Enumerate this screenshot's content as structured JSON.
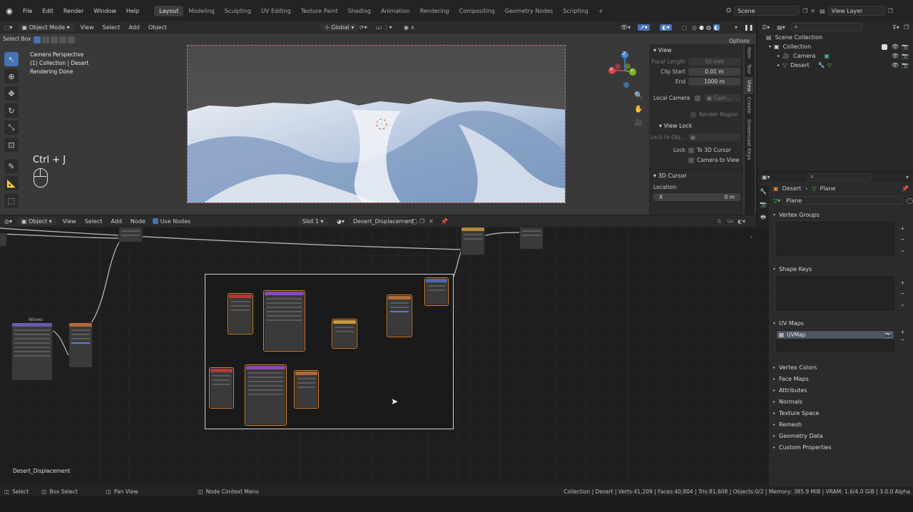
{
  "topbar": {
    "menus": [
      "File",
      "Edit",
      "Render",
      "Window",
      "Help"
    ],
    "workspaces": [
      "Layout",
      "Modeling",
      "Sculpting",
      "UV Editing",
      "Texture Paint",
      "Shading",
      "Animation",
      "Rendering",
      "Compositing",
      "Geometry Nodes",
      "Scripting"
    ],
    "active_workspace": "Layout",
    "add_tab": "+",
    "scene_name": "Scene",
    "view_layer": "View Layer"
  },
  "viewport_header": {
    "select_box": "Select Box",
    "mode": "Object Mode",
    "menus": [
      "View",
      "Select",
      "Add",
      "Object"
    ],
    "transform_orientation": "Global",
    "options": "Options"
  },
  "viewport": {
    "overlay_lines": [
      "Camera Perspective",
      "(1) Collection | Desert",
      "Rendering Done"
    ],
    "shortcut_label": "Ctrl + J",
    "gizmo_axes": {
      "x": "X",
      "y": "Y",
      "z": "Z"
    }
  },
  "npanel": {
    "tabs": [
      "Item",
      "Tool",
      "View",
      "Create",
      "Screencast Keys"
    ],
    "view_header": "View",
    "focal_length_label": "Focal Length",
    "focal_length_value": "50 mm",
    "clip_start_label": "Clip Start",
    "clip_start_value": "0.01 m",
    "end_label": "End",
    "end_value": "1000 m",
    "local_camera_label": "Local Camera",
    "local_camera_value": "Cam...",
    "render_region_label": "Render Region",
    "view_lock_header": "View Lock",
    "lock_to_obj_label": "Lock to Obj...",
    "lock_label": "Lock",
    "to_3d_cursor": "To 3D Cursor",
    "camera_to_view": "Camera to View",
    "cursor_header": "3D Cursor",
    "location_label": "Location:",
    "x_label": "X",
    "x_value": "0 m"
  },
  "outliner": {
    "root": "Scene Collection",
    "collection": "Collection",
    "items": [
      "Camera",
      "Desert"
    ]
  },
  "properties": {
    "object_name": "Desert",
    "mesh_name": "Plane",
    "mesh_field": "Plane",
    "sections_open": [
      "Vertex Groups",
      "Shape Keys",
      "UV Maps"
    ],
    "uv_map": "UVMap",
    "sections_closed": [
      "Vertex Colors",
      "Face Maps",
      "Attributes",
      "Normals",
      "Texture Space",
      "Remesh",
      "Geometry Data",
      "Custom Properties"
    ]
  },
  "node_editor_header": {
    "editor_type": "Object",
    "menus": [
      "View",
      "Select",
      "Add",
      "Node"
    ],
    "use_nodes": "Use Nodes",
    "slot": "Slot 1",
    "material": "Desert_Displacement"
  },
  "node_editor": {
    "waves_node_label": "Waves",
    "material_label": "Desert_Displacement"
  },
  "statusbar": {
    "select": "Select",
    "box_select": "Box Select",
    "pan_view": "Pan View",
    "context_menu": "Node Context Menu",
    "stats": "Collection | Desert | Verts:41,209 | Faces:40,804 | Tris:81,608 | Objects:0/2 | Memory: 385.9 MiB | VRAM: 1.6/4.0 GiB | 3.0.0 Alpha"
  },
  "colors": {
    "accent": "#4772b3",
    "selection_outline": "#d9822b",
    "axis_x": "#e0454f",
    "axis_y": "#7fb529",
    "axis_z": "#4585d6"
  }
}
